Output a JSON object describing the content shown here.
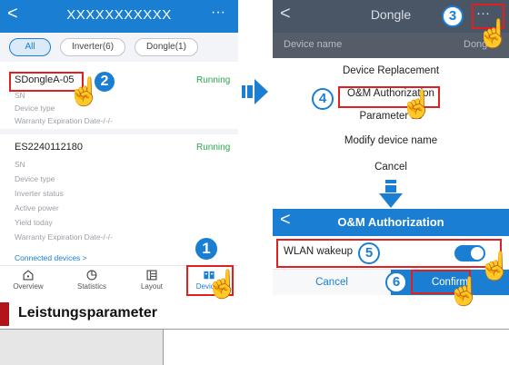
{
  "left_screen": {
    "title": "XXXXXXXXXXX",
    "back_glyph": "<",
    "more_glyph": "···",
    "filters": [
      {
        "label": "All",
        "active": true
      },
      {
        "label": "Inverter(6)",
        "active": false
      },
      {
        "label": "Dongle(1)",
        "active": false
      }
    ],
    "device1": {
      "name": "SDongleA-05",
      "status": "Running",
      "fields": [
        "SN",
        "Device type",
        "Warranty Expiration Date-/-/-"
      ]
    },
    "device2": {
      "name": "ES2240112180",
      "status": "Running",
      "fields": [
        "SN",
        "Device type",
        "Inverter status",
        "Active power",
        "Yield today",
        "Warranty Expiration Date-/-/-"
      ],
      "link": "Connected devices >"
    },
    "nav": [
      {
        "label": "Overview",
        "icon": "home-icon"
      },
      {
        "label": "Statistics",
        "icon": "pie-chart-icon"
      },
      {
        "label": "Layout",
        "icon": "layout-icon"
      },
      {
        "label": "Devices",
        "icon": "devices-icon",
        "active": true
      }
    ]
  },
  "top_right_screen": {
    "title": "Dongle",
    "back_glyph": "<",
    "more_glyph": "···",
    "device_name_label": "Device name",
    "device_name_value_partial": "Dong",
    "menu": [
      "Device Replacement",
      "O&M Authorization",
      "Parameter se",
      "Modify device name",
      "Cancel"
    ]
  },
  "bottom_right_screen": {
    "title": "O&M Authorization",
    "back_glyph": "<",
    "wlan_label": "WLAN wakeup",
    "wlan_on": true,
    "cancel_label": "Cancel",
    "confirm_label": "Confirm"
  },
  "callouts": {
    "c1": "1",
    "c2": "2",
    "c3": "3",
    "c4": "4",
    "c5": "5",
    "c6": "6"
  },
  "section_heading": "Leistungsparameter",
  "colors": {
    "brand_blue": "#1a7fd3",
    "running_green": "#2aa84a",
    "highlight_red": "#e02020",
    "dim_header": "#4a5566",
    "section_marker": "#b3141c"
  }
}
